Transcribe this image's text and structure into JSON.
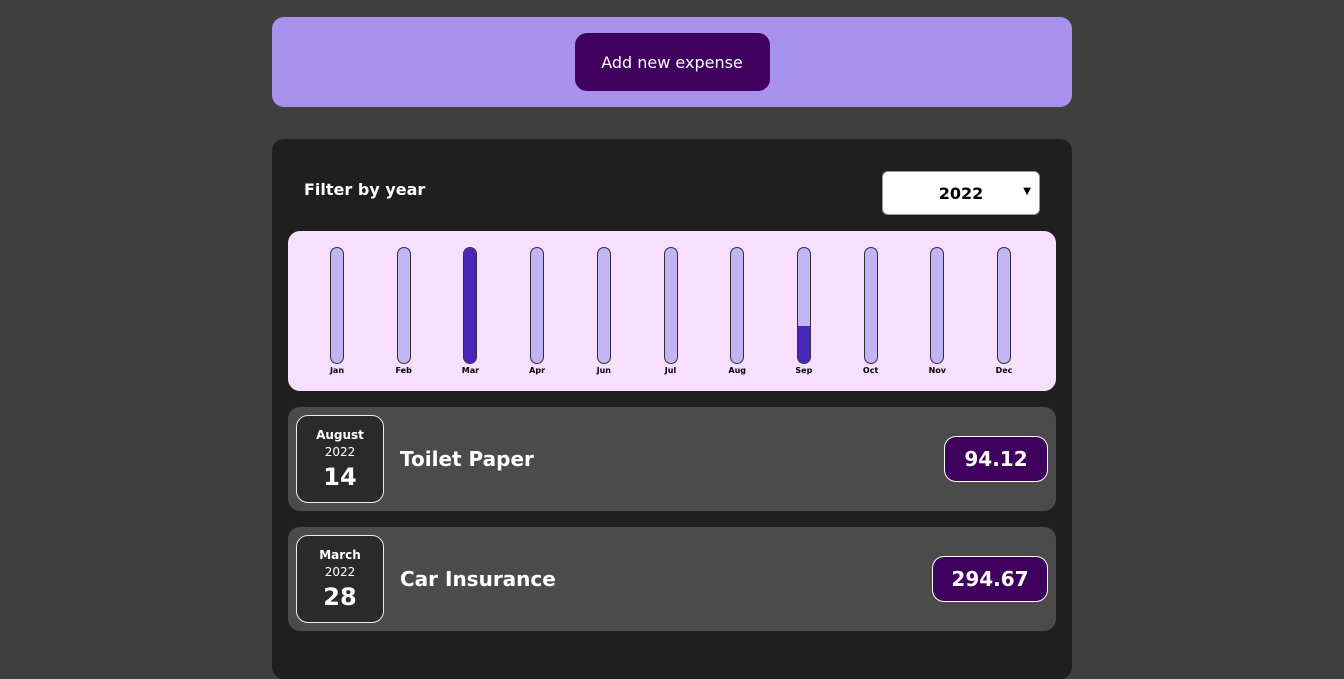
{
  "new_expense": {
    "add_button_label": "Add new expense"
  },
  "filter": {
    "label": "Filter by year",
    "selected_year": "2022"
  },
  "chart_data": {
    "type": "bar",
    "categories": [
      "Jan",
      "Feb",
      "Mar",
      "Apr",
      "Jun",
      "Jul",
      "Aug",
      "Sep",
      "Oct",
      "Nov",
      "Dec"
    ],
    "values": [
      0,
      0,
      294.67,
      0,
      0,
      0,
      0,
      94.12,
      0,
      0,
      0
    ],
    "fill_fractions": [
      0,
      0,
      1.0,
      0,
      0,
      0,
      0,
      0.32,
      0,
      0,
      0
    ],
    "colors": {
      "track": "#c3b4f3",
      "fill": "#4826b9",
      "background": "#f8dfff"
    }
  },
  "expenses": [
    {
      "month": "August",
      "year": "2022",
      "day": "14",
      "title": "Toilet Paper",
      "amount": "94.12"
    },
    {
      "month": "March",
      "year": "2022",
      "day": "28",
      "title": "Car Insurance",
      "amount": "294.67"
    }
  ],
  "colors": {
    "page_bg": "#3f3f3f",
    "accent_light": "#a892ee",
    "accent_dark": "#40005d",
    "panel_bg": "#1f1f1f",
    "item_bg": "#4b4b4b"
  }
}
